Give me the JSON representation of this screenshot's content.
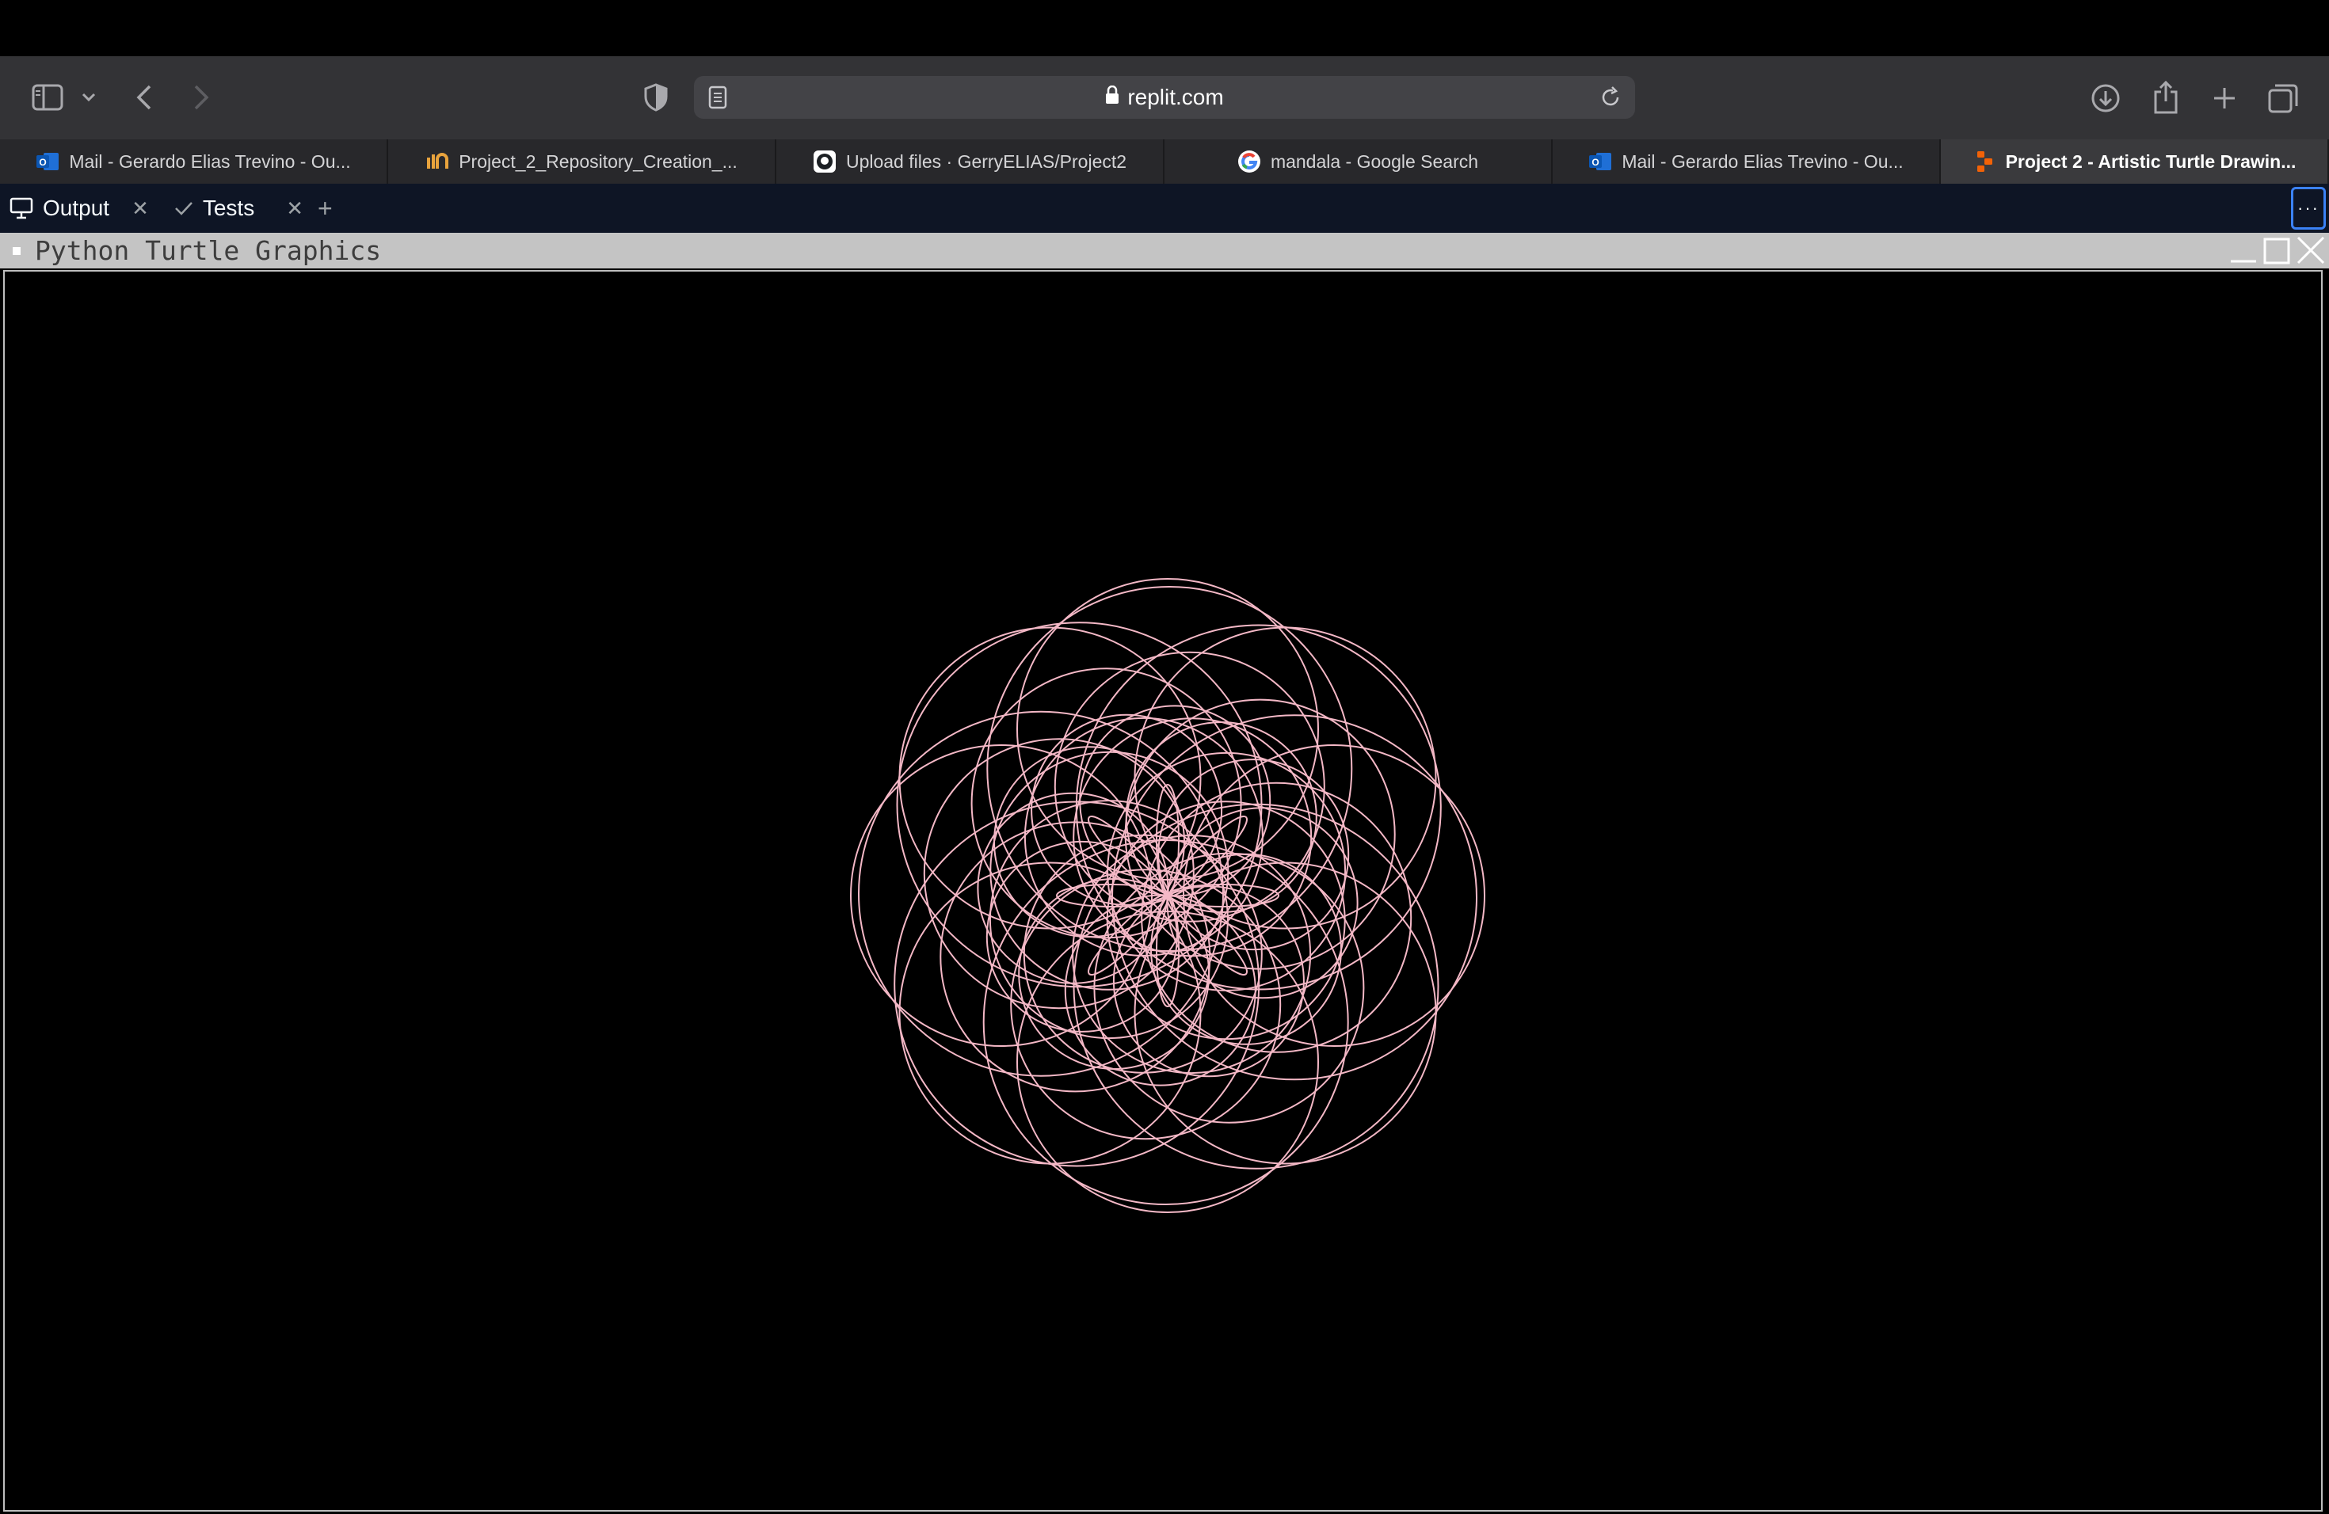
{
  "browser": {
    "url": "replit.com",
    "icons": [
      "sidebar-icon",
      "chevron-down-icon",
      "back-icon",
      "forward-icon",
      "shield-icon",
      "reader-icon",
      "lock-icon",
      "reload-icon",
      "download-icon",
      "share-icon",
      "new-tab-icon",
      "tab-overview-icon"
    ]
  },
  "tabs": [
    {
      "title": "Mail - Gerardo Elias Trevino - Ou...",
      "icon": "outlook-icon",
      "active": false
    },
    {
      "title": "Project_2_Repository_Creation_...",
      "icon": "mn-icon",
      "active": false
    },
    {
      "title": "Upload files · GerryELIAS/Project2",
      "icon": "github-icon",
      "active": false
    },
    {
      "title": "mandala - Google Search",
      "icon": "google-icon",
      "active": false
    },
    {
      "title": "Mail - Gerardo Elias Trevino - Ou...",
      "icon": "outlook-icon",
      "active": false
    },
    {
      "title": "Project 2 - Artistic Turtle Drawin...",
      "icon": "replit-icon",
      "active": true
    }
  ],
  "replit": {
    "tabs": [
      {
        "label": "Output",
        "icon": "monitor-icon"
      },
      {
        "label": "Tests",
        "icon": "check-icon"
      }
    ],
    "add_label": "+",
    "more_label": "···"
  },
  "turtle_window": {
    "title": "Python Turtle Graphics",
    "background": "#000000",
    "pen_color": "#f4b8c6",
    "drawing": "mandala of overlapping circles"
  }
}
